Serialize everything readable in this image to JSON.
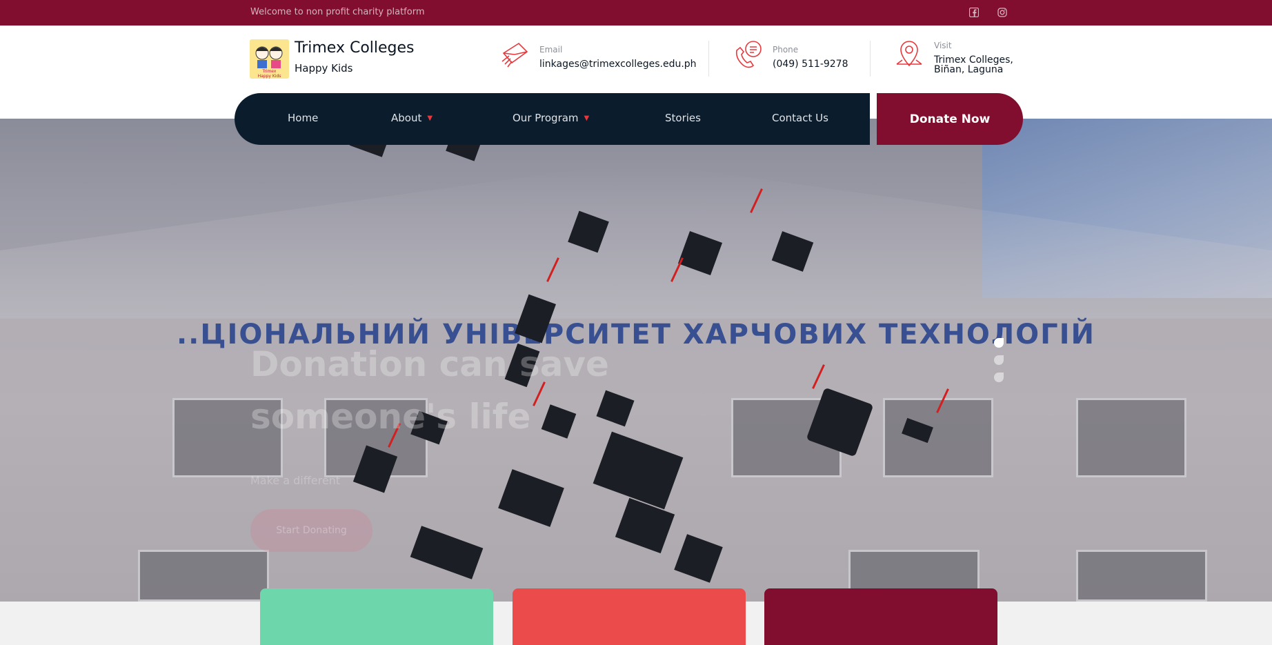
{
  "topbar": {
    "welcome": "Welcome to non profit charity platform",
    "social": [
      "facebook-icon",
      "instagram-icon"
    ]
  },
  "brand": {
    "name": "Trimex Colleges",
    "tagline": "Happy Kids"
  },
  "contacts": {
    "email": {
      "label": "Email",
      "value": "linkages@trimexcolleges.edu.ph",
      "icon": "envelope-icon"
    },
    "phone": {
      "label": "Phone",
      "value": "(049) 511-9278",
      "icon": "phone-icon"
    },
    "visit": {
      "label": "Visit",
      "value_line1": "Trimex Colleges,",
      "value_line2": "Biñan, Laguna",
      "icon": "map-pin-icon"
    }
  },
  "nav": {
    "items": [
      {
        "label": "Home",
        "dropdown": false
      },
      {
        "label": "About",
        "dropdown": true
      },
      {
        "label": "Our Program",
        "dropdown": true
      },
      {
        "label": "Stories",
        "dropdown": false
      },
      {
        "label": "Contact Us",
        "dropdown": false
      }
    ],
    "donate_label": "Donate Now"
  },
  "hero": {
    "building_text": "..ЦІОНАЛЬНИЙ УНІВЕРСИТЕТ ХАРЧОВИХ ТЕХНОЛОГІЙ",
    "headline": "Donation can save someone's life",
    "subtitle": "Make a different",
    "cta_label": "Start Donating",
    "slides": 3,
    "active_slide": 1
  },
  "cards": [
    {
      "color": "#6dd6ab"
    },
    {
      "color": "#ec4b4b"
    },
    {
      "color": "#820e2f"
    }
  ],
  "colors": {
    "brand": "#820e2f",
    "nav_bg": "#0b1c2c",
    "accent": "#e8383c"
  }
}
